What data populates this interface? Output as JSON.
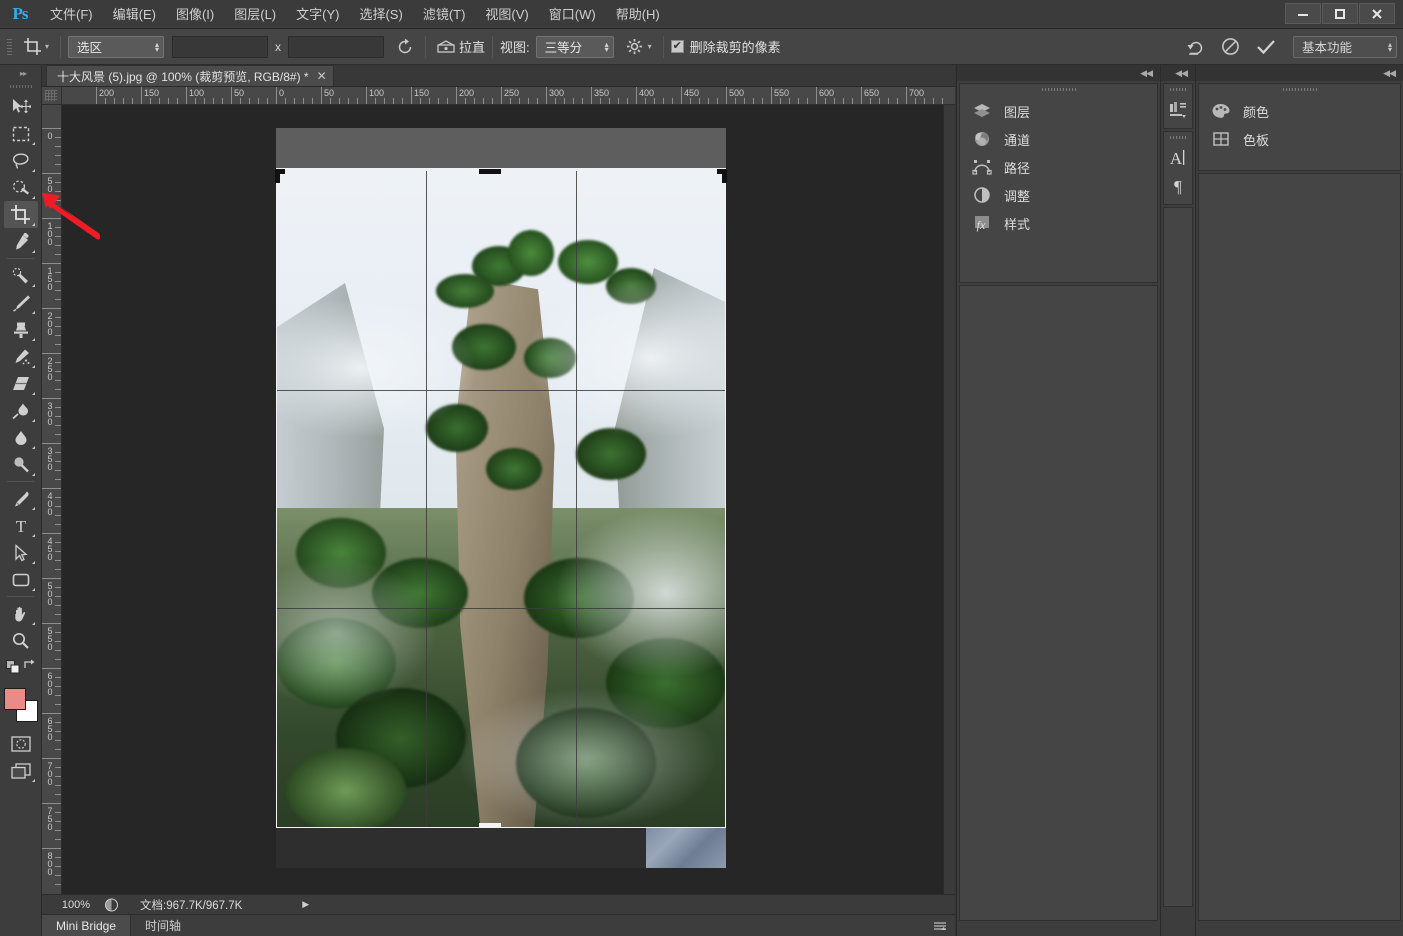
{
  "app": {
    "logo": "Ps",
    "accent": "#2bb3e8",
    "foreground_color": "#e98b87",
    "background_color": "#ffffff"
  },
  "titlebar": {
    "menus": [
      {
        "label": "文件(F)",
        "name": "menu-file"
      },
      {
        "label": "编辑(E)",
        "name": "menu-edit"
      },
      {
        "label": "图像(I)",
        "name": "menu-image"
      },
      {
        "label": "图层(L)",
        "name": "menu-layer"
      },
      {
        "label": "文字(Y)",
        "name": "menu-type"
      },
      {
        "label": "选择(S)",
        "name": "menu-select"
      },
      {
        "label": "滤镜(T)",
        "name": "menu-filter"
      },
      {
        "label": "视图(V)",
        "name": "menu-view"
      },
      {
        "label": "窗口(W)",
        "name": "menu-window"
      },
      {
        "label": "帮助(H)",
        "name": "menu-help"
      }
    ],
    "window_controls": {
      "minimize": "—",
      "maximize": "▣",
      "close": "✕"
    }
  },
  "options_bar": {
    "tool_icon": "crop-tool-icon",
    "preset_dropdown": {
      "value": "选区",
      "name": "crop-preset-select"
    },
    "width_field": {
      "value": "",
      "placeholder": ""
    },
    "multiply_symbol": "x",
    "height_field": {
      "value": "",
      "placeholder": ""
    },
    "swap_icon": "rotate-swap-icon",
    "straighten_label": "拉直",
    "view_label": "视图:",
    "view_dropdown": {
      "value": "三等分",
      "name": "crop-overlay-select"
    },
    "gear_icon": "gear-icon",
    "delete_cropped_checkbox": {
      "label": "删除裁剪的像素",
      "checked": true
    },
    "reset_icon": "reset-icon",
    "cancel_icon": "cancel-icon",
    "commit_icon": "commit-check-icon",
    "workspace": {
      "value": "基本功能",
      "name": "workspace-select"
    }
  },
  "toolbar": {
    "collapse_icon": "expand-toolbar-icon",
    "tools": [
      {
        "name": "move-tool",
        "label": "移动工具",
        "active": false,
        "has_submenu": false
      },
      {
        "name": "marquee-tool",
        "label": "矩形选框工具",
        "active": false,
        "has_submenu": true
      },
      {
        "name": "lasso-tool",
        "label": "套索工具",
        "active": false,
        "has_submenu": true
      },
      {
        "name": "quick-selection-tool",
        "label": "快速选择工具",
        "active": false,
        "has_submenu": true
      },
      {
        "name": "crop-tool",
        "label": "裁剪工具",
        "active": true,
        "has_submenu": true
      },
      {
        "name": "eyedropper-tool",
        "label": "吸管工具",
        "active": false,
        "has_submenu": true
      },
      {
        "name": "healing-brush-tool",
        "label": "污点修复画笔工具",
        "active": false,
        "has_submenu": true
      },
      {
        "name": "brush-tool",
        "label": "画笔工具",
        "active": false,
        "has_submenu": true
      },
      {
        "name": "clone-stamp-tool",
        "label": "仿制图章工具",
        "active": false,
        "has_submenu": true
      },
      {
        "name": "history-brush-tool",
        "label": "历史记录画笔工具",
        "active": false,
        "has_submenu": true
      },
      {
        "name": "eraser-tool",
        "label": "橡皮擦工具",
        "active": false,
        "has_submenu": true
      },
      {
        "name": "gradient-tool",
        "label": "渐变工具",
        "active": false,
        "has_submenu": true
      },
      {
        "name": "blur-tool",
        "label": "模糊工具",
        "active": false,
        "has_submenu": true
      },
      {
        "name": "dodge-tool",
        "label": "减淡工具",
        "active": false,
        "has_submenu": true
      },
      {
        "name": "pen-tool",
        "label": "钢笔工具",
        "active": false,
        "has_submenu": true
      },
      {
        "name": "type-tool",
        "label": "横排文字工具",
        "active": false,
        "has_submenu": true
      },
      {
        "name": "path-selection-tool",
        "label": "路径选择工具",
        "active": false,
        "has_submenu": true
      },
      {
        "name": "rectangle-shape-tool",
        "label": "矩形工具",
        "active": false,
        "has_submenu": true
      },
      {
        "name": "hand-tool",
        "label": "抓手工具",
        "active": false,
        "has_submenu": true
      },
      {
        "name": "zoom-tool",
        "label": "缩放工具",
        "active": false,
        "has_submenu": false
      }
    ],
    "quick_mask_label": "以快速蒙版模式编辑",
    "screen_mode_label": "更改屏幕模式"
  },
  "document_tab": {
    "title": "十大风景 (5).jpg @ 100% (裁剪预览, RGB/8#) *",
    "close_icon": "✕"
  },
  "rulers": {
    "horizontal_labels": [
      "200",
      "150",
      "100",
      "50",
      "0",
      "50",
      "100",
      "150",
      "200",
      "250",
      "300",
      "350",
      "400",
      "450",
      "500",
      "550",
      "600",
      "65"
    ],
    "vertical_labels": [
      "0",
      "50",
      "100",
      "150",
      "200",
      "250",
      "300",
      "350",
      "400",
      "450",
      "500",
      "550",
      "600",
      "650",
      "700",
      "7"
    ],
    "unit": "px"
  },
  "canvas": {
    "crop_overlay": "三等分",
    "zoom": "100%"
  },
  "panels": {
    "mid": {
      "collapse_icon": "collapse-panel-icon",
      "items": [
        {
          "label": "图层",
          "name": "panel-item-layers",
          "icon": "layers-icon"
        },
        {
          "label": "通道",
          "name": "panel-item-channels",
          "icon": "channels-icon"
        },
        {
          "label": "路径",
          "name": "panel-item-paths",
          "icon": "paths-icon"
        },
        {
          "label": "调整",
          "name": "panel-item-adjustments",
          "icon": "adjustments-icon"
        },
        {
          "label": "样式",
          "name": "panel-item-styles",
          "icon": "styles-fx-icon"
        }
      ]
    },
    "icon_column": {
      "collapse_icon": "collapse-panel-icon",
      "groups": [
        {
          "buttons": [
            {
              "icon": "histogram-icon",
              "name": "panel-icon-histogram"
            }
          ]
        },
        {
          "buttons": [
            {
              "icon": "character-A-icon",
              "name": "panel-icon-character"
            },
            {
              "icon": "paragraph-pilcrow-icon",
              "name": "panel-icon-paragraph"
            }
          ]
        }
      ]
    },
    "right": {
      "collapse_icon": "collapse-panel-icon",
      "items": [
        {
          "label": "颜色",
          "name": "panel-item-color",
          "icon": "color-palette-icon"
        },
        {
          "label": "色板",
          "name": "panel-item-swatches",
          "icon": "swatches-grid-icon"
        }
      ]
    }
  },
  "status_bar": {
    "zoom": "100%",
    "status_icon": "document-preview-icon",
    "doc_info": "文档:967.7K/967.7K",
    "expand_arrow": "▶"
  },
  "bottom_bar": {
    "tabs": [
      {
        "label": "Mini Bridge",
        "name": "tab-mini-bridge",
        "active": true
      },
      {
        "label": "时间轴",
        "name": "tab-timeline",
        "active": false
      }
    ],
    "menu_icon": "panel-menu-icon"
  },
  "annotation": {
    "arrow": "red-pointer-arrow",
    "color": "#ee1c25",
    "target": "crop-tool"
  }
}
